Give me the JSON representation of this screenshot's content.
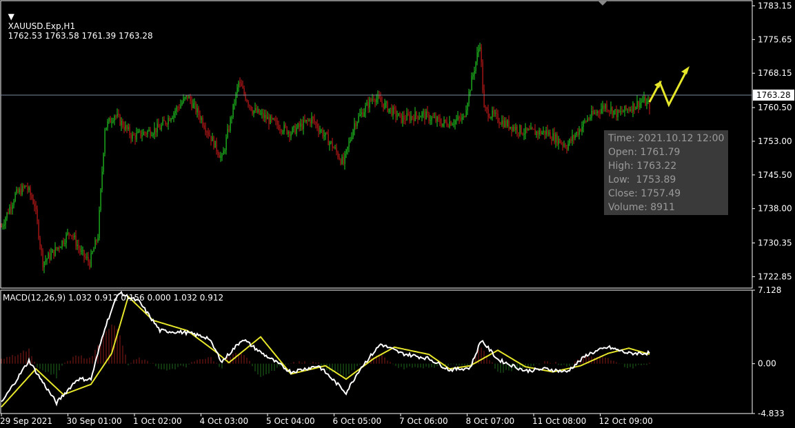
{
  "colors": {
    "background": "#000000",
    "bull": "#22d422",
    "bear": "#cc1a1a",
    "grid": "#ffffff",
    "price_line": "#7a8aa0",
    "macd_line": "#ffffff",
    "signal_line": "#e6e62a",
    "hist_up": "#8b1a1a",
    "hist_down": "#1f6b1f",
    "arrow": "#e6e62a"
  },
  "header": {
    "symbol": "XAUUSD.Exp,H1",
    "ohlc": "1762.53 1763.58 1761.39 1763.28",
    "arrow_icon": "triangle-down"
  },
  "current_price": "1763.28",
  "macd_header": "MACD(12,26,9) 1.032 0.912 0.156 0.000 1.032 0.912",
  "tooltip": {
    "time": "Time: 2021.10.12 12:00",
    "open": "Open: 1761.79",
    "high": "High: 1763.22",
    "low": "Low:  1753.89",
    "close": "Close: 1757.49",
    "volume": "Volume: 8911"
  },
  "chart_data": [
    {
      "type": "candlestick",
      "title": "XAUUSD.Exp,H1",
      "ylim": [
        1720.3,
        1784.3
      ],
      "y_ticks": [
        "1783.15",
        "1775.65",
        "1768.15",
        "1760.50",
        "1753.00",
        "1745.50",
        "1738.00",
        "1730.35",
        "1722.85"
      ],
      "y_tick_values": [
        1783.15,
        1775.65,
        1768.15,
        1760.5,
        1753.0,
        1745.5,
        1738.0,
        1730.35,
        1722.85
      ],
      "x_ticks": [
        "29 Sep 2021",
        "30 Sep 01:00",
        "1 Oct 02:00",
        "4 Oct 03:00",
        "5 Oct 04:00",
        "6 Oct 05:00",
        "7 Oct 06:00",
        "8 Oct 07:00",
        "11 Oct 08:00",
        "12 Oct 09:00"
      ],
      "current_price": 1763.28,
      "close_anchors": [
        [
          0,
          1734
        ],
        [
          10,
          1741
        ],
        [
          18,
          1743
        ],
        [
          24,
          1739
        ],
        [
          30,
          1726
        ],
        [
          40,
          1729
        ],
        [
          50,
          1733
        ],
        [
          58,
          1728
        ],
        [
          64,
          1726
        ],
        [
          70,
          1732
        ],
        [
          75,
          1756
        ],
        [
          82,
          1759
        ],
        [
          95,
          1754
        ],
        [
          115,
          1756
        ],
        [
          135,
          1763
        ],
        [
          145,
          1758
        ],
        [
          160,
          1749
        ],
        [
          172,
          1766
        ],
        [
          182,
          1760
        ],
        [
          198,
          1757
        ],
        [
          210,
          1755
        ],
        [
          225,
          1758
        ],
        [
          240,
          1752
        ],
        [
          248,
          1748
        ],
        [
          256,
          1757
        ],
        [
          270,
          1763
        ],
        [
          290,
          1758
        ],
        [
          305,
          1759
        ],
        [
          320,
          1757
        ],
        [
          335,
          1758
        ],
        [
          347,
          1775
        ],
        [
          350,
          1760
        ],
        [
          365,
          1757
        ],
        [
          380,
          1755
        ],
        [
          395,
          1755
        ],
        [
          410,
          1752
        ],
        [
          425,
          1758
        ],
        [
          438,
          1761
        ],
        [
          447,
          1759
        ],
        [
          465,
          1762
        ],
        [
          470,
          1761
        ]
      ],
      "count": 471
    },
    {
      "type": "macd",
      "label": "MACD(12,26,9) 1.032 0.912 0.156 0.000 1.032 0.912",
      "ylim": [
        -4.833,
        7.128
      ],
      "y_ticks": [
        "7.128",
        "0.00",
        "-4.833"
      ],
      "macd_anchors": [
        [
          0,
          -3.8
        ],
        [
          20,
          0.3
        ],
        [
          30,
          -1.8
        ],
        [
          40,
          -3.8
        ],
        [
          55,
          -1.5
        ],
        [
          65,
          -1.5
        ],
        [
          75,
          3.5
        ],
        [
          85,
          6.9
        ],
        [
          100,
          6
        ],
        [
          115,
          3.2
        ],
        [
          135,
          3
        ],
        [
          150,
          2.5
        ],
        [
          160,
          0.2
        ],
        [
          175,
          2.4
        ],
        [
          188,
          1.1
        ],
        [
          210,
          -0.8
        ],
        [
          230,
          -0.2
        ],
        [
          250,
          -2.8
        ],
        [
          260,
          -0.5
        ],
        [
          275,
          1.9
        ],
        [
          290,
          1
        ],
        [
          310,
          0.5
        ],
        [
          325,
          -0.6
        ],
        [
          340,
          -0.4
        ],
        [
          348,
          2.3
        ],
        [
          360,
          0.4
        ],
        [
          380,
          -0.7
        ],
        [
          395,
          -0.5
        ],
        [
          410,
          -0.8
        ],
        [
          425,
          0.9
        ],
        [
          440,
          1.6
        ],
        [
          455,
          1.0
        ],
        [
          470,
          1.032
        ]
      ],
      "signal_anchors": [
        [
          0,
          -4.2
        ],
        [
          25,
          -0.5
        ],
        [
          45,
          -3
        ],
        [
          65,
          -2
        ],
        [
          80,
          1
        ],
        [
          92,
          6.5
        ],
        [
          110,
          4.2
        ],
        [
          135,
          3.2
        ],
        [
          155,
          1.2
        ],
        [
          165,
          0.1
        ],
        [
          188,
          2.6
        ],
        [
          210,
          -1.0
        ],
        [
          235,
          -0.2
        ],
        [
          250,
          -1.5
        ],
        [
          270,
          0.5
        ],
        [
          285,
          1.6
        ],
        [
          310,
          0.9
        ],
        [
          325,
          -0.5
        ],
        [
          340,
          -0.2
        ],
        [
          360,
          1.3
        ],
        [
          380,
          -0.3
        ],
        [
          400,
          -0.8
        ],
        [
          420,
          -0.2
        ],
        [
          440,
          1.0
        ],
        [
          455,
          1.5
        ],
        [
          470,
          0.912
        ]
      ]
    }
  ]
}
